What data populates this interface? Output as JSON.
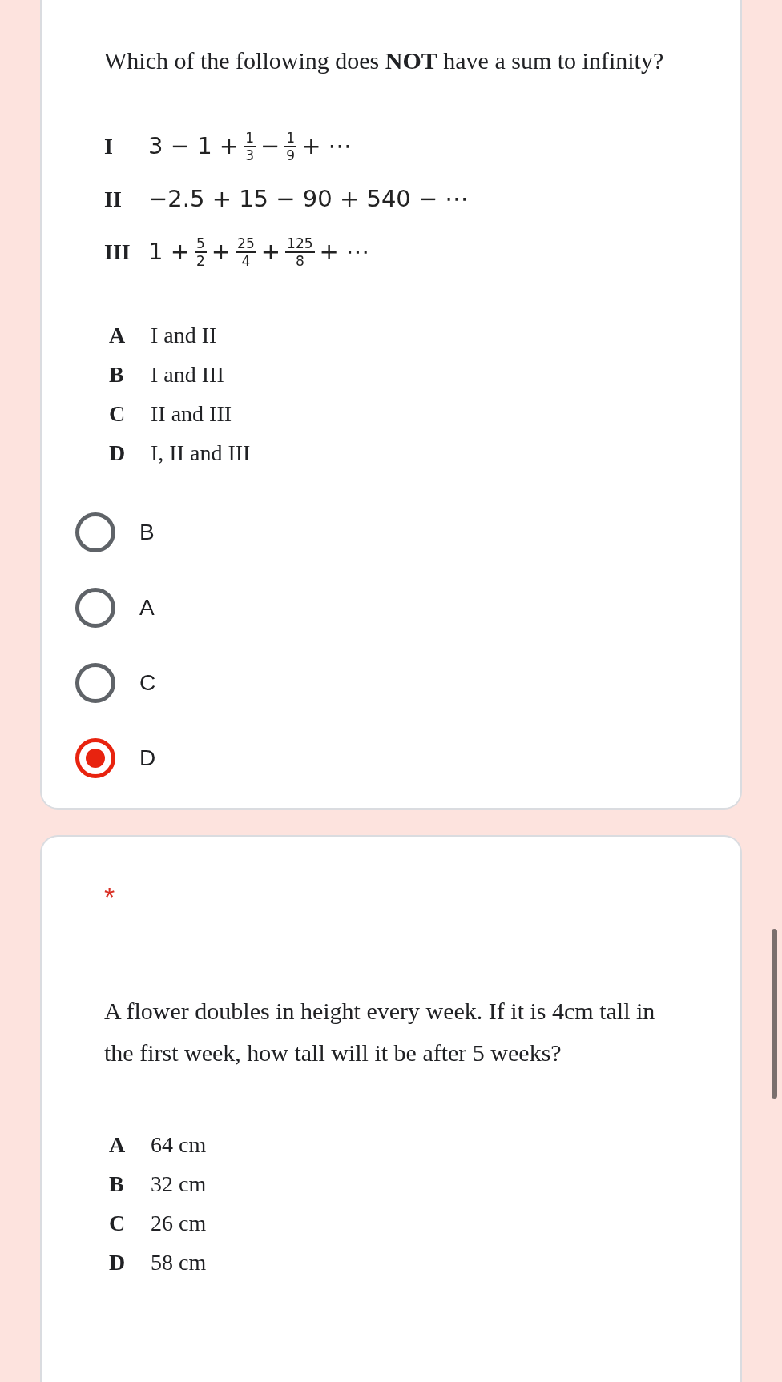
{
  "questions": [
    {
      "prompt": "Which of the following does **NOT** have a sum to infinity?",
      "statements": [
        {
          "numeral": "I",
          "terms": [
            {
              "kind": "text",
              "text": "3 − 1 +"
            },
            {
              "kind": "frac",
              "num": "1",
              "den": "3"
            },
            {
              "kind": "text",
              "text": "−"
            },
            {
              "kind": "frac",
              "num": "1",
              "den": "9"
            },
            {
              "kind": "text",
              "text": "+ ⋯"
            }
          ]
        },
        {
          "numeral": "II",
          "terms": [
            {
              "kind": "text",
              "text": "−2.5 + 15 − 90 + 540 − ⋯"
            }
          ]
        },
        {
          "numeral": "III",
          "terms": [
            {
              "kind": "text",
              "text": "1 +"
            },
            {
              "kind": "frac",
              "num": "5",
              "den": "2"
            },
            {
              "kind": "text",
              "text": "+"
            },
            {
              "kind": "frac",
              "num": "25",
              "den": "4"
            },
            {
              "kind": "text",
              "text": "+"
            },
            {
              "kind": "frac",
              "num": "125",
              "den": "8"
            },
            {
              "kind": "text",
              "text": "+ ⋯"
            }
          ]
        }
      ],
      "options": [
        {
          "letter": "A",
          "text": "I and II"
        },
        {
          "letter": "B",
          "text": "I and III"
        },
        {
          "letter": "C",
          "text": "II and III"
        },
        {
          "letter": "D",
          "text": "I, II and III"
        }
      ],
      "choices": [
        {
          "label": "B",
          "selected": false
        },
        {
          "label": "A",
          "selected": false
        },
        {
          "label": "C",
          "selected": false
        },
        {
          "label": "D",
          "selected": true
        }
      ]
    },
    {
      "required_mark": "*",
      "prompt": "A flower doubles in height every week. If it is 4cm tall in the first week, how tall will it be after 5 weeks?",
      "options": [
        {
          "letter": "A",
          "text": "64 cm"
        },
        {
          "letter": "B",
          "text": "32 cm"
        },
        {
          "letter": "C",
          "text": "26 cm"
        },
        {
          "letter": "D",
          "text": "58 cm"
        }
      ]
    }
  ]
}
